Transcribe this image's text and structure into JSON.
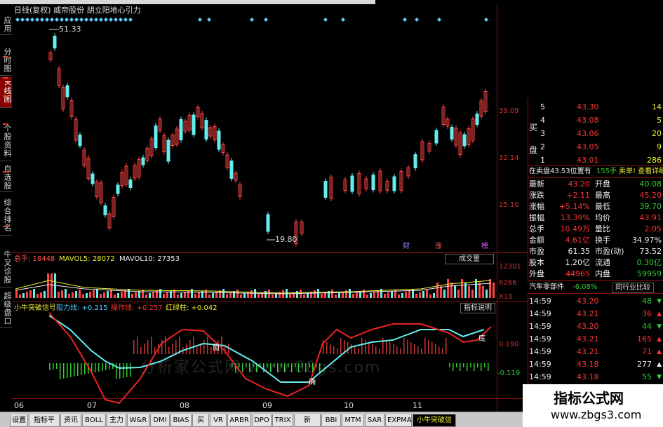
{
  "window": {
    "title": "日线(复权) 威帝股份 胡立阳地心引力"
  },
  "left_tabs": [
    "应用",
    "分时图",
    "K线图",
    "个股资料",
    "自选股",
    "综合排名",
    "牛叉诊股",
    "超级盘口"
  ],
  "price_chart": {
    "high_label": "51.33",
    "low_label": "19.80",
    "y_labels": [
      "39.09",
      "32.14",
      "25.10"
    ],
    "markers": [
      "财",
      "涨",
      "榜"
    ]
  },
  "volume_panel": {
    "total_label": "总手: 18448",
    "ma5_label": "MAVOL5: 28072",
    "ma10_label": "MAVOL10: 27353",
    "y_labels": [
      "12301",
      "6266",
      "X10"
    ],
    "dropdown": "成交量"
  },
  "indicator_panel": {
    "name": "小牛突破信号",
    "resistance": "阻力线: +0.215",
    "operation": "操作线: +0.257",
    "redgreen": "红绿柱: +0.042",
    "button": "指标说明",
    "y_labels": [
      "0.190",
      "-0.119"
    ],
    "labels": [
      "阻",
      "确",
      "底"
    ]
  },
  "x_axis": [
    "06",
    "07",
    "08",
    "09",
    "10",
    "11"
  ],
  "watermark": "分析家公式网 www.88gs.com",
  "quote": {
    "sell": [
      {
        "n": "5",
        "p": "43.30",
        "v": "14"
      },
      {
        "n": "4",
        "p": "43.08",
        "v": "5"
      },
      {
        "n": "3",
        "p": "43.06",
        "v": "20"
      },
      {
        "n": "2",
        "p": "43.05",
        "v": "9"
      },
      {
        "n": "1",
        "p": "43.01",
        "v": "286"
      }
    ],
    "side_labels": [
      "买",
      "盘"
    ],
    "status_left": "在卖盘43.53位置有",
    "status_mid": "155手",
    "status_right": "卖单! 查看详细",
    "fields": [
      {
        "l": "最新",
        "v": "43.20",
        "l2": "开盘",
        "v2": "40.08"
      },
      {
        "l": "涨跌",
        "v": "+2.11",
        "l2": "最高",
        "v2": "45.20"
      },
      {
        "l": "涨幅",
        "v": "+5.14%",
        "l2": "最低",
        "v2": "39.70"
      },
      {
        "l": "振幅",
        "v": "13.39%",
        "l2": "均价",
        "v2": "43.91"
      },
      {
        "l": "总手",
        "v": "10.49万",
        "l2": "量比",
        "v2": "2.05"
      },
      {
        "l": "金额",
        "v": "4.61亿",
        "l2": "换手",
        "v2": "34.97%"
      },
      {
        "l": "市盈",
        "v": "61.35",
        "l2": "市盈(动)",
        "v2": "73.52"
      },
      {
        "l": "股本",
        "v": "1.20亿",
        "l2": "流通",
        "v2": "0.30亿"
      },
      {
        "l": "外盘",
        "v": "44965",
        "l2": "内盘",
        "v2": "59959"
      }
    ],
    "sector": {
      "name": "汽车零部件",
      "change": "-6.08%",
      "button": "同行业比较"
    },
    "ticks": [
      {
        "t": "14:59",
        "p": "43.20",
        "v": "48",
        "d": "down"
      },
      {
        "t": "14:59",
        "p": "43.21",
        "v": "36",
        "d": "up"
      },
      {
        "t": "14:59",
        "p": "43.20",
        "v": "44",
        "d": "down"
      },
      {
        "t": "14:59",
        "p": "43.21",
        "v": "165",
        "d": "up"
      },
      {
        "t": "14:59",
        "p": "43.21",
        "v": "71",
        "d": "up"
      },
      {
        "t": "14:59",
        "p": "43.18",
        "v": "277",
        "d": "neutral"
      },
      {
        "t": "14:59",
        "p": "43.18",
        "v": "55",
        "d": "down"
      },
      {
        "t": "14:59",
        "p": "43.17",
        "v": "74",
        "d": "down"
      }
    ]
  },
  "bottom_tabs": [
    "设置",
    "指标平台",
    "资讯",
    "BOLL",
    "主力",
    "W&R",
    "DMI",
    "BIAS",
    "买卖",
    "VR",
    "ARBR",
    "DPO",
    "TRIX",
    "新DMA",
    "BBI",
    "MTM",
    "SAR",
    "EXPMA",
    "小牛突破信号"
  ],
  "logo": {
    "title": "指标公式网",
    "url": "www.zbgs3.com"
  }
}
